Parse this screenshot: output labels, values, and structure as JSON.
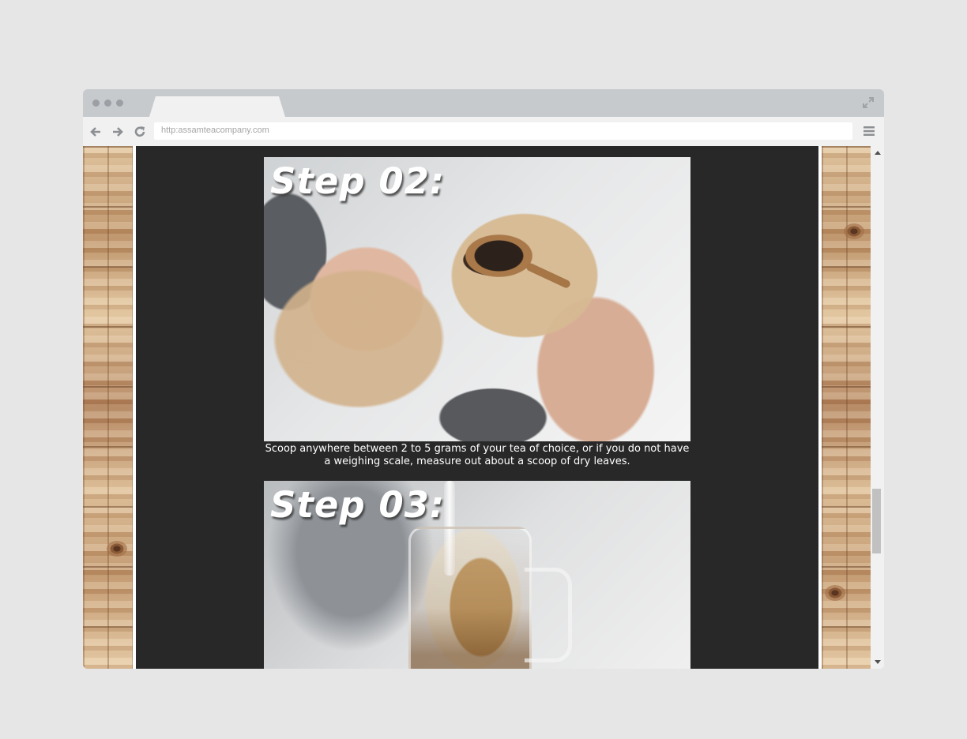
{
  "browser": {
    "url": "http:assamteacompany.com"
  },
  "content": {
    "steps": [
      {
        "title": "Step 02:",
        "caption": "Scoop anywhere between 2 to 5 grams of your tea of choice, or if you do not have a weighing scale, measure out about a scoop of dry leaves."
      },
      {
        "title": "Step 03:"
      }
    ]
  },
  "colors": {
    "page_background": "#e6e6e6",
    "content_background": "#282828",
    "titlebar": "#c7cacd",
    "navbar": "#f1f1f1"
  },
  "icons": [
    "expand-icon",
    "back-arrow-icon",
    "forward-arrow-icon",
    "reload-icon",
    "hamburger-menu-icon"
  ]
}
